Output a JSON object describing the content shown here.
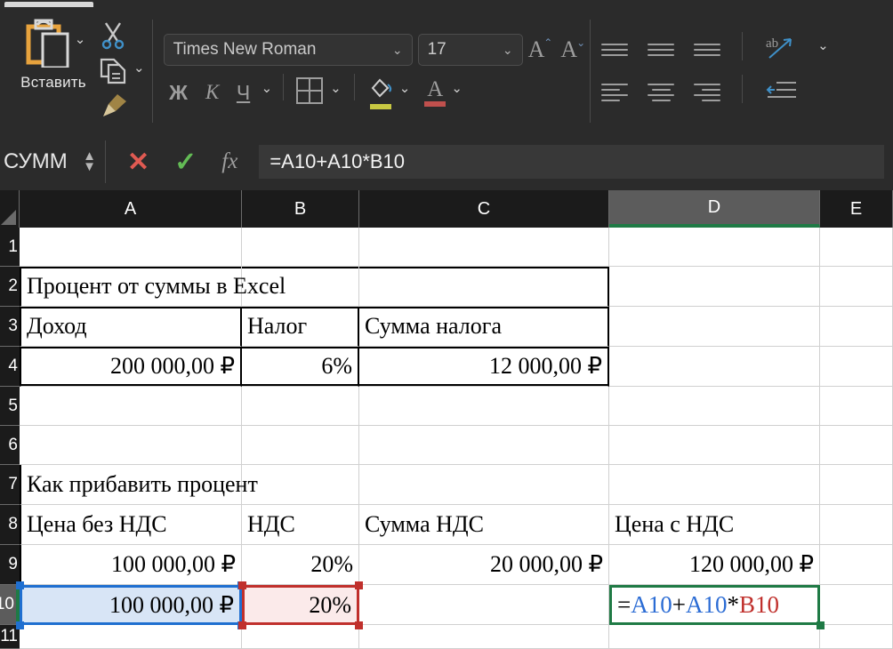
{
  "app": {
    "locale": "ru",
    "accent_green": "#1f7a45",
    "ref_blue": "#2b6cd4",
    "ref_red": "#c0302c"
  },
  "ribbon": {
    "clipboard": {
      "paste_label": "Вставить",
      "paste_icon": "clipboard-icon",
      "paste_dropdown_icon": "chevron-down-icon",
      "cut_icon": "scissors-icon",
      "copy_icon": "copy-icon",
      "copy_dropdown_icon": "chevron-down-icon",
      "format_painter_icon": "format-painter-icon"
    },
    "font": {
      "font_name": "Times New Roman",
      "font_name_dropdown_icon": "chevron-down-icon",
      "font_size": "17",
      "font_size_dropdown_icon": "chevron-down-icon",
      "grow_font_label": "A",
      "shrink_font_label": "A",
      "bold_label": "Ж",
      "italic_label": "К",
      "underline_label": "Ч",
      "underline_dropdown_icon": "chevron-down-icon",
      "borders_icon": "borders-icon",
      "borders_dropdown_icon": "chevron-down-icon",
      "fill_color_icon": "fill-color-icon",
      "fill_color_swatch": "#c8c842",
      "fill_dropdown_icon": "chevron-down-icon",
      "font_color_label": "A",
      "font_color_swatch": "#c0504d",
      "font_color_dropdown_icon": "chevron-down-icon"
    },
    "alignment": {
      "align_top_icon": "align-top-icon",
      "align_middle_icon": "align-middle-icon",
      "align_bottom_icon": "align-bottom-icon",
      "orientation_icon": "text-orientation-icon",
      "orientation_dropdown_icon": "chevron-down-icon",
      "align_left_icon": "align-left-icon",
      "align_center_icon": "align-center-icon",
      "align_right_icon": "align-right-icon",
      "decrease_indent_icon": "decrease-indent-icon"
    }
  },
  "formula_bar": {
    "name_box_value": "СУММ",
    "name_box_spinner_icon": "spinner-updown-icon",
    "cancel_icon": "cancel-x-icon",
    "confirm_icon": "confirm-check-icon",
    "insert_function_icon": "fx-icon",
    "formula": "=A10+A10*B10"
  },
  "grid": {
    "columns": [
      {
        "label": "A",
        "active": false
      },
      {
        "label": "B",
        "active": false
      },
      {
        "label": "C",
        "active": false
      },
      {
        "label": "D",
        "active": true
      },
      {
        "label": "E",
        "active": false
      }
    ],
    "rows": [
      {
        "label": "1",
        "active": false
      },
      {
        "label": "2",
        "active": false
      },
      {
        "label": "3",
        "active": false
      },
      {
        "label": "4",
        "active": false
      },
      {
        "label": "5",
        "active": false
      },
      {
        "label": "6",
        "active": false
      },
      {
        "label": "7",
        "active": false
      },
      {
        "label": "8",
        "active": false
      },
      {
        "label": "9",
        "active": false
      },
      {
        "label": "10",
        "active": true
      },
      {
        "label": "11",
        "active": false
      }
    ],
    "cells": {
      "a2": "Процент от суммы в Excel",
      "a3": "Доход",
      "b3": "Налог",
      "c3": "Сумма налога",
      "a4": "200 000,00 ₽",
      "b4": "6%",
      "c4": "12 000,00 ₽",
      "a7": "Как прибавить процент",
      "a8": "Цена без НДС",
      "b8": "НДС",
      "c8": "Сумма НДС",
      "d8": "Цена с НДС",
      "a9": "100 000,00 ₽",
      "b9": "20%",
      "c9": "20 000,00 ₽",
      "d9": "120 000,00 ₽",
      "a10": "100 000,00 ₽",
      "b10": "20%",
      "d10_tokens": {
        "eq": "=",
        "ref1": "A10",
        "plus": "+",
        "ref2": "A10",
        "star": "*",
        "ref3": "B10"
      }
    }
  }
}
